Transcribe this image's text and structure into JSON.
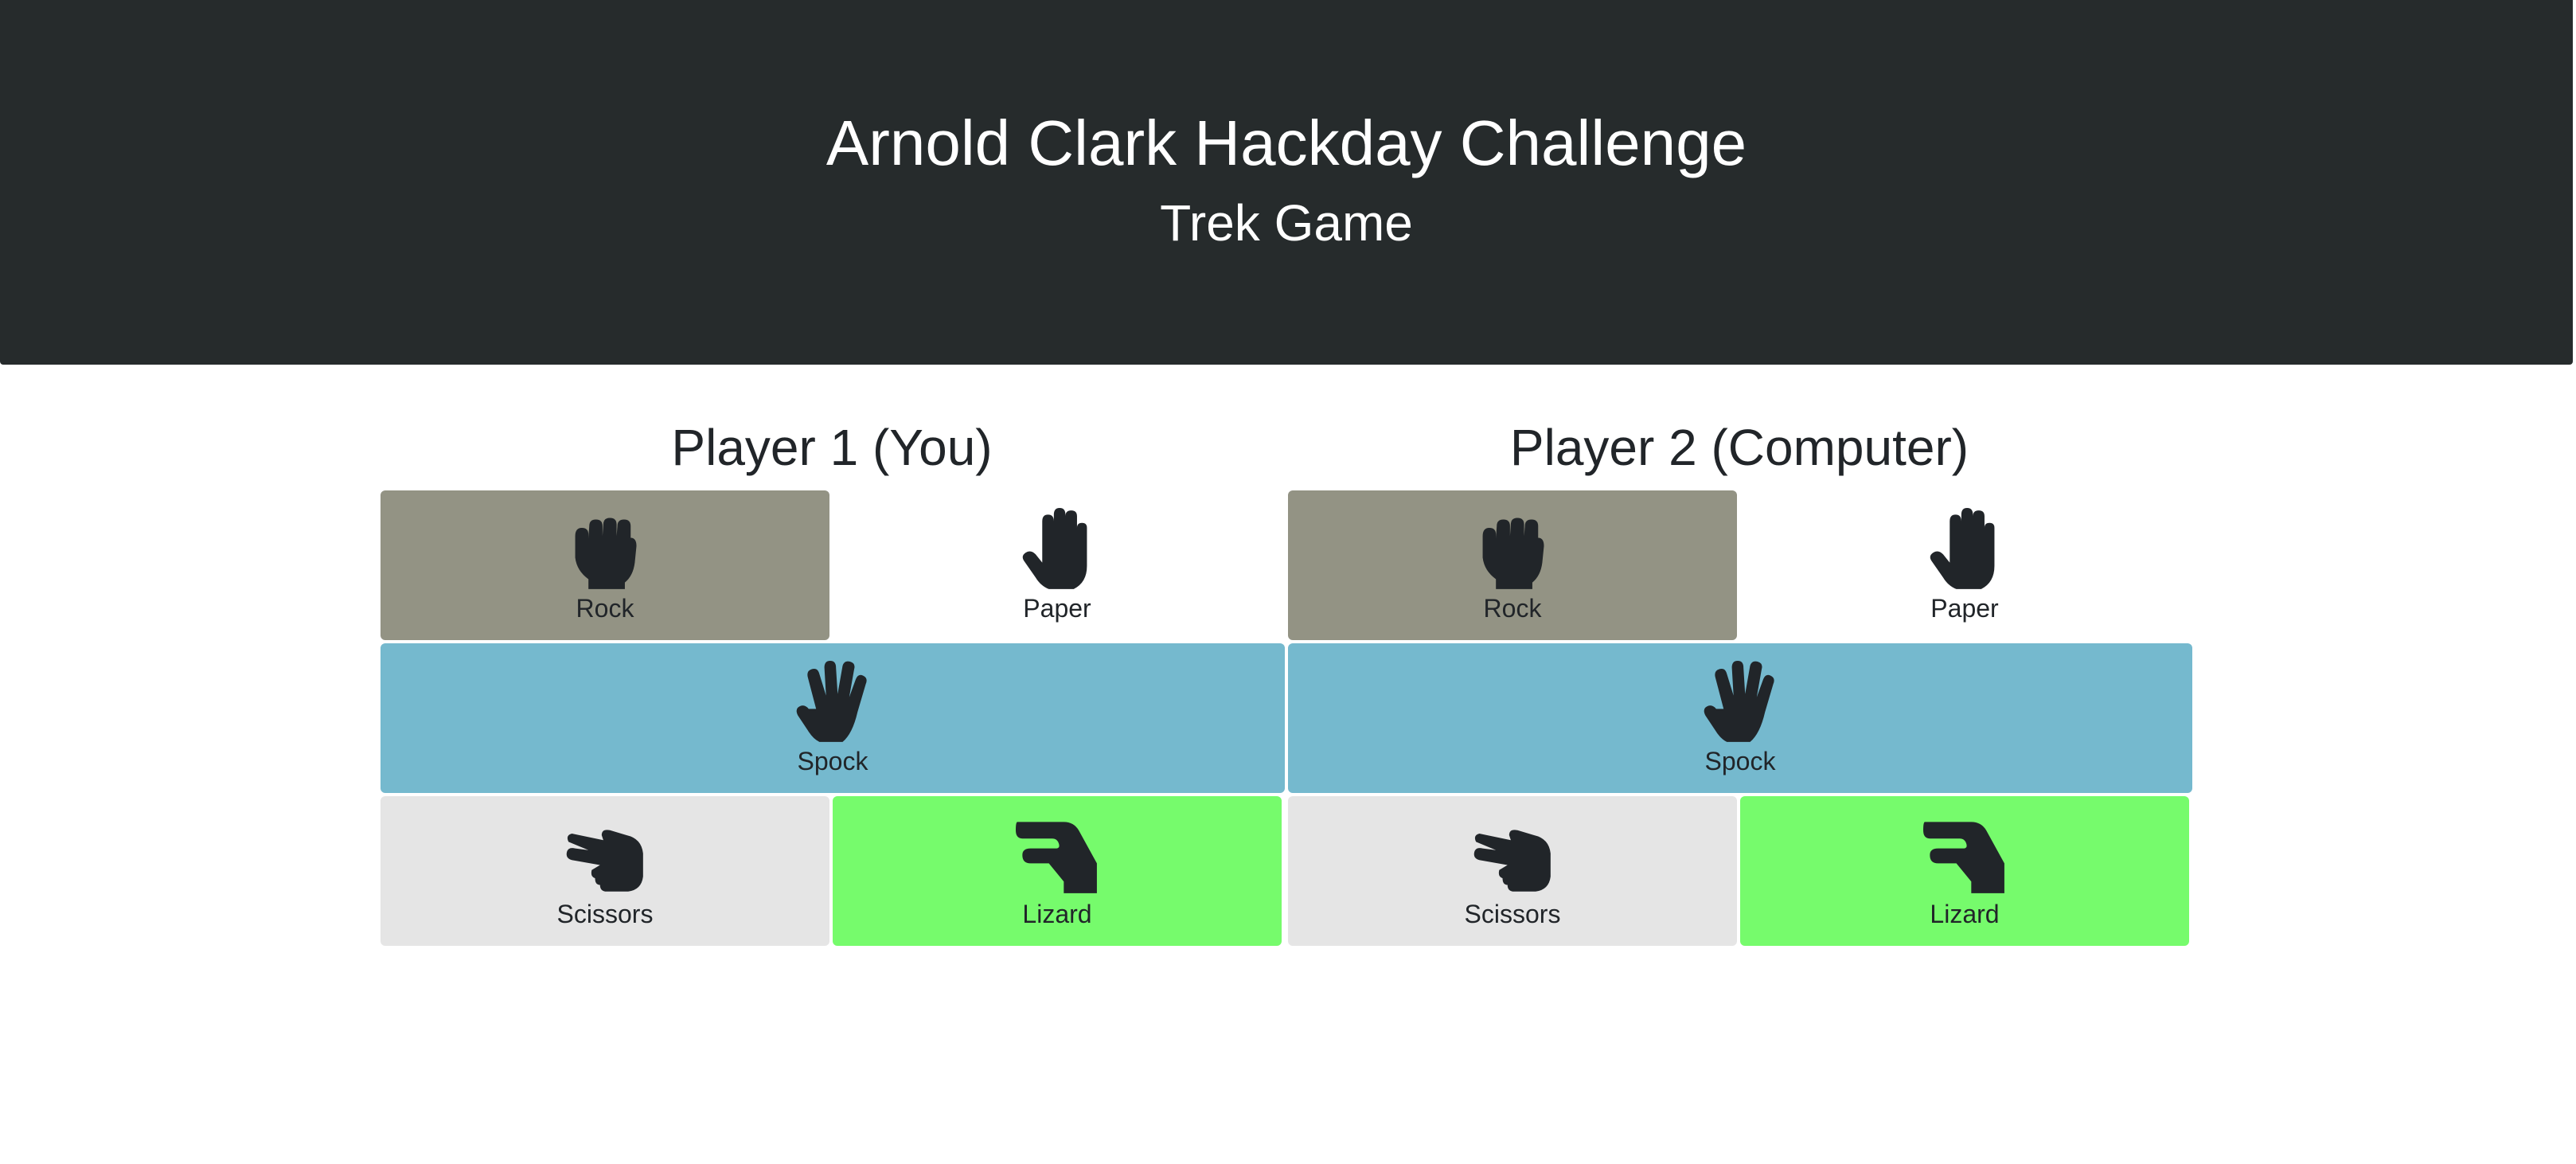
{
  "header": {
    "title": "Arnold Clark Hackday Challenge",
    "subtitle": "Trek Game"
  },
  "colors": {
    "header_bg": "#262b2c",
    "rock_bg": "#939384",
    "spock_bg": "#75b9ce",
    "scissors_bg": "#e5e5e5",
    "lizard_bg": "#76fb6c",
    "icon": "#212529"
  },
  "players": [
    {
      "title": "Player 1 (You)",
      "choices": {
        "rock": {
          "label": "Rock",
          "icon": "hand-rock-icon"
        },
        "paper": {
          "label": "Paper",
          "icon": "hand-paper-icon"
        },
        "spock": {
          "label": "Spock",
          "icon": "hand-spock-icon"
        },
        "scissors": {
          "label": "Scissors",
          "icon": "hand-scissors-icon"
        },
        "lizard": {
          "label": "Lizard",
          "icon": "hand-lizard-icon"
        }
      }
    },
    {
      "title": "Player 2 (Computer)",
      "choices": {
        "rock": {
          "label": "Rock",
          "icon": "hand-rock-icon"
        },
        "paper": {
          "label": "Paper",
          "icon": "hand-paper-icon"
        },
        "spock": {
          "label": "Spock",
          "icon": "hand-spock-icon"
        },
        "scissors": {
          "label": "Scissors",
          "icon": "hand-scissors-icon"
        },
        "lizard": {
          "label": "Lizard",
          "icon": "hand-lizard-icon"
        }
      }
    }
  ]
}
